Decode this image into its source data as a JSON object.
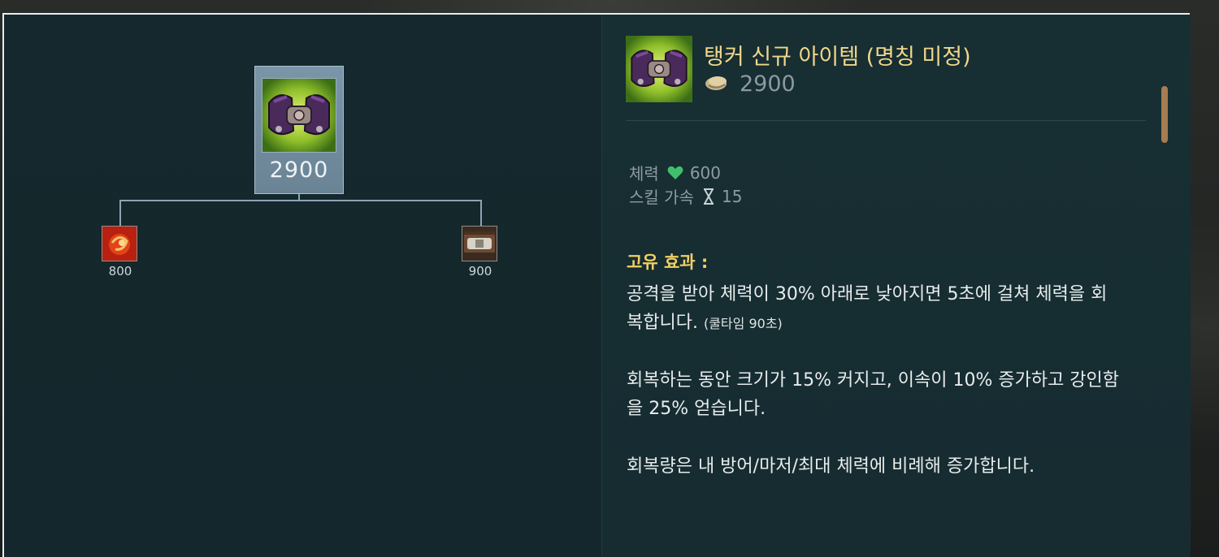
{
  "recipe_tree": {
    "main_item": {
      "cost": "2900",
      "icon": "tank-belt-item-icon"
    },
    "components": [
      {
        "cost": "800",
        "icon": "red-orb-item-icon"
      },
      {
        "cost": "900",
        "icon": "leather-belt-item-icon"
      }
    ]
  },
  "item_detail": {
    "name": "탱커 신규 아이템 (명칭 미정)",
    "gold_icon": "gold-coin-icon",
    "price": "2900",
    "stats": [
      {
        "label": "체력",
        "icon": "heart-icon",
        "value": "600"
      },
      {
        "label": "스킬 가속",
        "icon": "hourglass-icon",
        "value": "15"
      }
    ],
    "passive": {
      "title": "고유 효과 :",
      "p1_main": "공격을 받아 체력이 30% 아래로 낮아지면 5초에 걸쳐 체력을 회복합니다.",
      "p1_note": "(쿨타임 90초)",
      "p2": "회복하는 동안 크기가 15% 커지고, 이속이 10% 증가하고 강인함을 25% 얻습니다.",
      "p3": "회복량은 내 방어/마저/최대 체력에 비례해 증가합니다."
    }
  },
  "colors": {
    "panel_bg": "#152a2f",
    "item_name": "#f0d78a",
    "unique_title": "#f0d065",
    "heart": "#3fbf6a",
    "scroll_thumb": "#a67c52"
  }
}
